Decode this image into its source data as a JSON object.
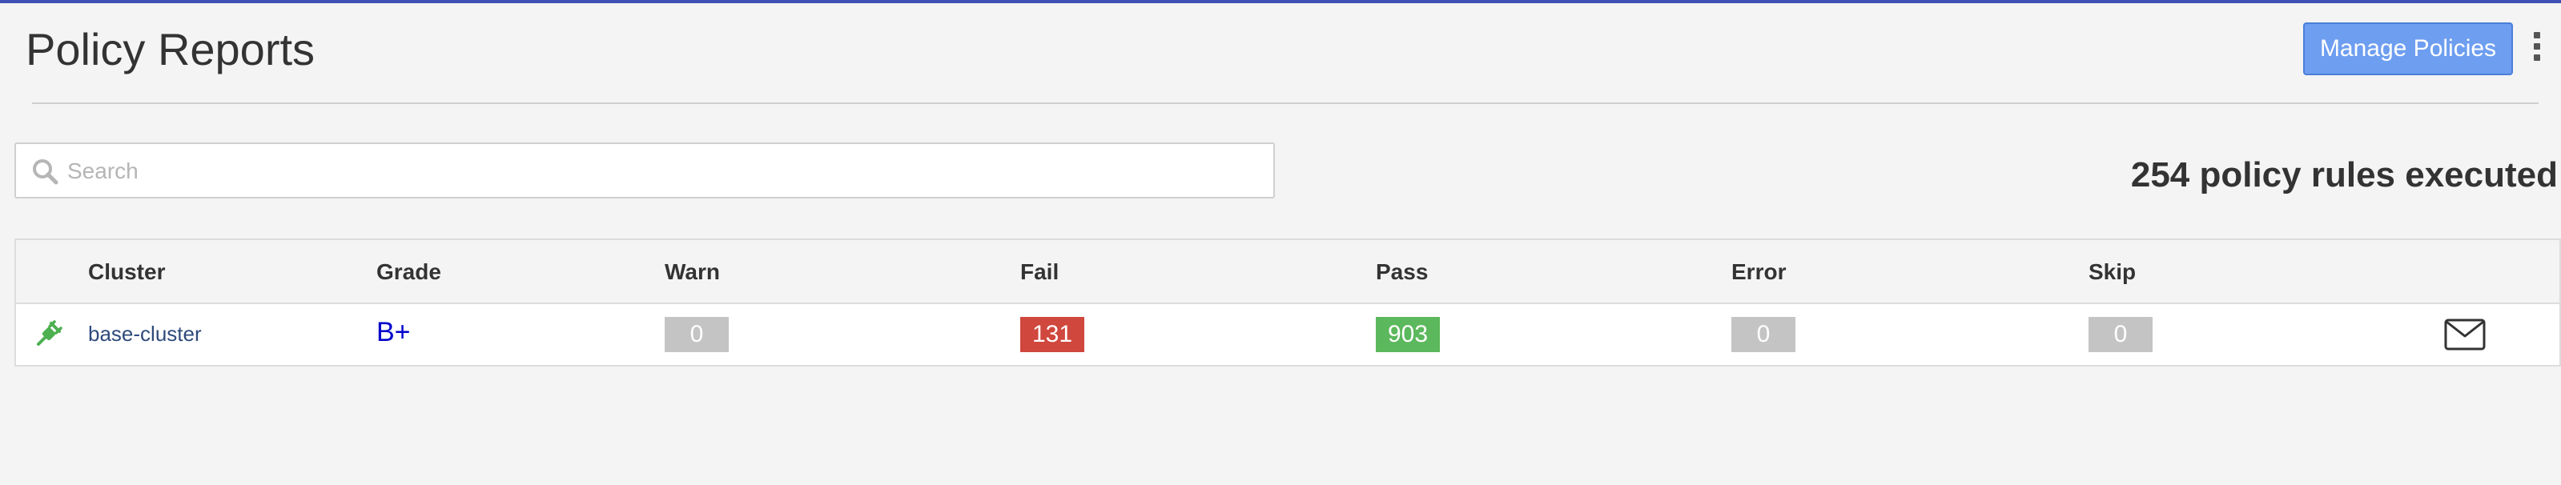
{
  "header": {
    "title": "Policy Reports",
    "manage_button_label": "Manage Policies",
    "menu_icon": "kebab-menu-icon",
    "accent_color": "#3f51b5",
    "button_color": "#6e9ef0"
  },
  "search": {
    "placeholder": "Search",
    "value": "",
    "icon": "search-icon"
  },
  "summary": {
    "text": "254 policy rules executed"
  },
  "table": {
    "columns": [
      "Cluster",
      "Grade",
      "Warn",
      "Fail",
      "Pass",
      "Error",
      "Skip"
    ],
    "rows": [
      {
        "status_icon": "plug-connected-icon",
        "cluster": "base-cluster",
        "grade": "B+",
        "warn": "0",
        "fail": "131",
        "pass": "903",
        "error": "0",
        "skip": "0",
        "action_icon": "mail-icon"
      }
    ],
    "colors": {
      "fail": "#d0473d",
      "pass": "#5cb85c",
      "neutral": "#c4c4c4",
      "grade": "#0000cc",
      "link": "#2f4b7c"
    }
  }
}
